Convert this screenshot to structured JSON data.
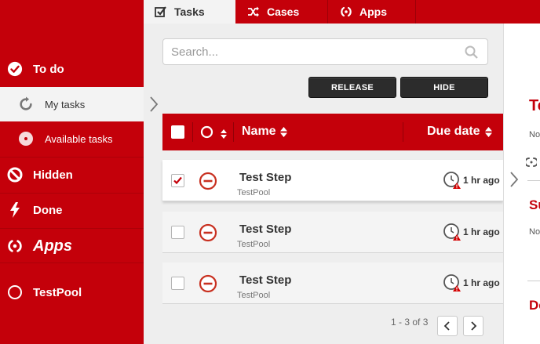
{
  "colors": {
    "brand": "#c4000a",
    "dark_button": "#2c2c2c"
  },
  "sidebar": {
    "todo": {
      "label": "To do",
      "icon": "check-circle-icon"
    },
    "my_tasks": {
      "label": "My tasks",
      "icon": "refresh-icon"
    },
    "available_tasks": {
      "label": "Available tasks",
      "icon": "target-icon"
    },
    "hidden": {
      "label": "Hidden",
      "icon": "blocked-icon"
    },
    "done": {
      "label": "Done",
      "icon": "lightning-icon"
    },
    "apps": {
      "label": "Apps",
      "icon": "apps-icon"
    },
    "testpool": {
      "label": "TestPool",
      "icon": "circle-icon"
    }
  },
  "tabs": [
    {
      "label": "Tasks",
      "icon": "checkbox-icon",
      "active": true
    },
    {
      "label": "Cases",
      "icon": "shuffle-icon",
      "active": false
    },
    {
      "label": "Apps",
      "icon": "apps-icon",
      "active": false
    }
  ],
  "search": {
    "placeholder": "Search...",
    "value": ""
  },
  "toolbar": {
    "release_label": "RELEASE",
    "hide_label": "HIDE"
  },
  "table": {
    "columns": {
      "name": "Name",
      "due_date": "Due date"
    },
    "rows": [
      {
        "name": "Test Step",
        "pool": "TestPool",
        "due": "1 hr ago",
        "checked": true
      },
      {
        "name": "Test Step",
        "pool": "TestPool",
        "due": "1 hr ago",
        "checked": false
      },
      {
        "name": "Test Step",
        "pool": "TestPool",
        "due": "1 hr ago",
        "checked": false
      }
    ]
  },
  "pager": {
    "text": "1 - 3 of 3"
  },
  "right_panel": {
    "heading1": "Te",
    "sub1": "No",
    "heading2": "Su",
    "sub2": "No",
    "heading3": "De"
  }
}
